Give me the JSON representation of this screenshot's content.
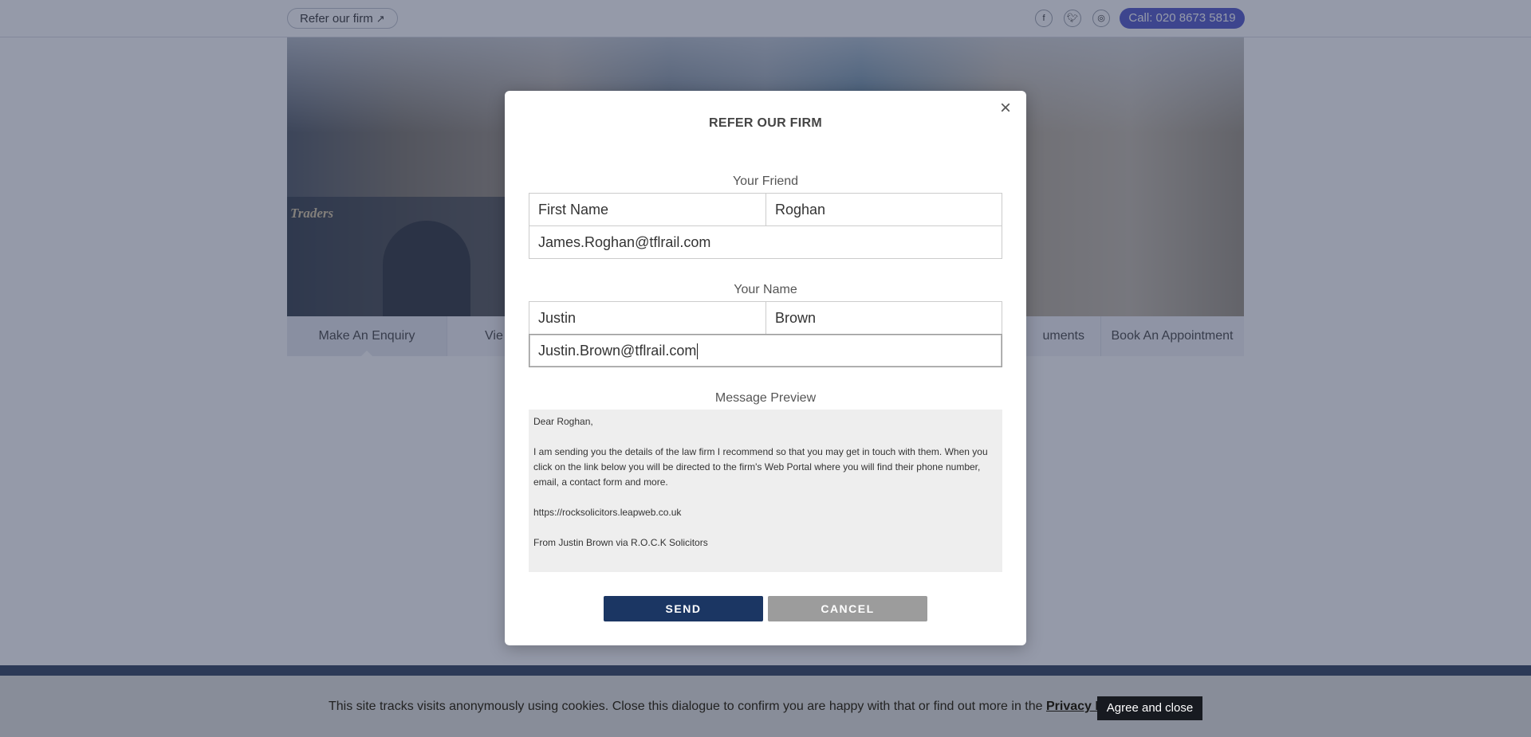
{
  "header": {
    "refer_label": "Refer our firm",
    "social_icons": [
      "facebook-icon",
      "twitter-icon",
      "globe-icon"
    ],
    "call_label": "Call: 020 8673 5819",
    "call_color": "#4e54c8"
  },
  "hero": {
    "sign_text": "Traders"
  },
  "tabs": [
    {
      "label": "Make An Enquiry",
      "active": true
    },
    {
      "label": "Vie"
    },
    {
      "label": "uments"
    },
    {
      "label": "Book An Appointment"
    }
  ],
  "cookie": {
    "text": "This site tracks visits anonymously using cookies. Close this dialogue to confirm you are happy with that or find out more in the",
    "link_label": "Privacy Policy",
    "end": ".",
    "agree_label": "Agree and close"
  },
  "modal": {
    "title": "REFER OUR FIRM",
    "friend_label": "Your Friend",
    "friend_first_name": "First Name",
    "friend_last_name": "Roghan",
    "friend_email": "James.Roghan@tflrail.com",
    "your_label": "Your Name",
    "your_first_name": "Justin",
    "your_last_name": "Brown",
    "your_email": "Justin.Brown@tflrail.com",
    "preview_label": "Message Preview",
    "preview": {
      "greeting": "Dear Roghan,",
      "body": "I am sending you the details of the law firm I recommend so that you may get in touch with them. When you click on the link below you will be directed to the firm's Web Portal where you will find their phone number, email, a contact form and more.",
      "link": "https://rocksolicitors.leapweb.co.uk",
      "signoff": "From Justin Brown via R.O.C.K Solicitors"
    },
    "send_label": "SEND",
    "cancel_label": "CANCEL",
    "send_color": "#1b3663"
  }
}
